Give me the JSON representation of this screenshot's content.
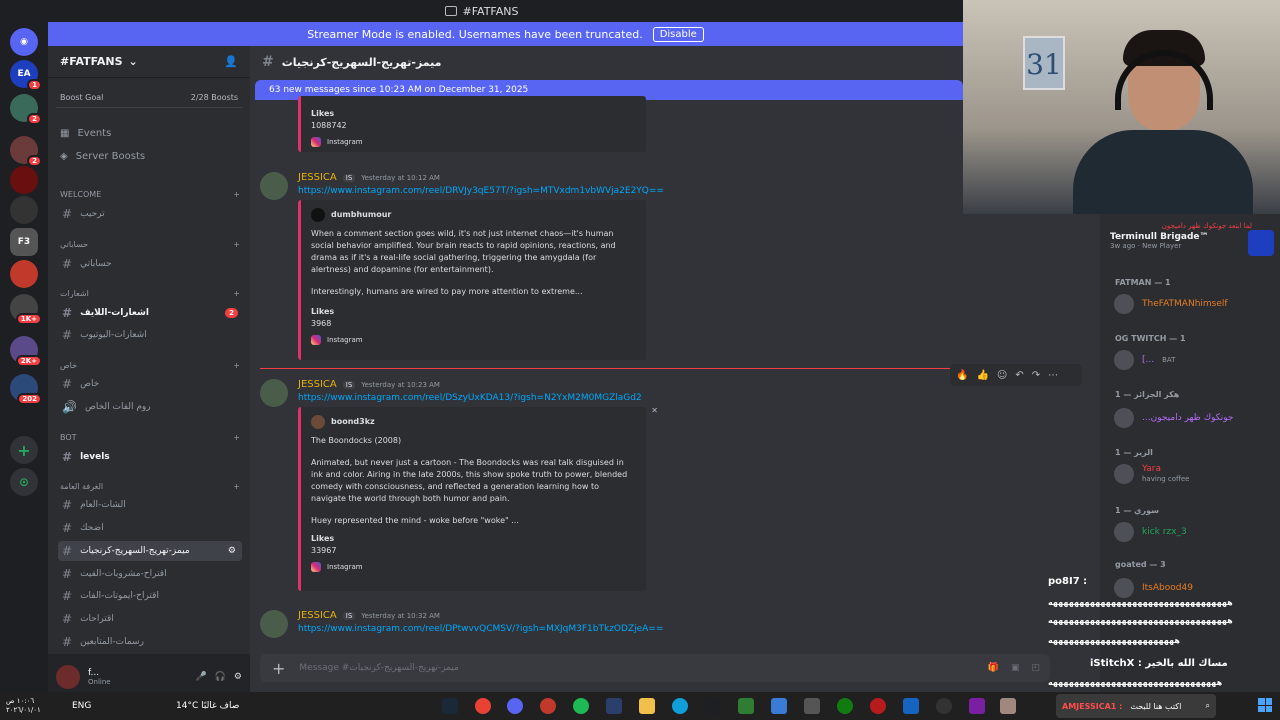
{
  "window": {
    "title": "#FATFANS"
  },
  "banner": {
    "text": "Streamer Mode is enabled. Usernames have been truncated.",
    "button": "Disable"
  },
  "servers": [
    {
      "label": "EA",
      "badge": "1",
      "color": "#1d3fbf"
    },
    {
      "label": "",
      "badge": "2",
      "color": "#3a6b5a"
    },
    {
      "label": "",
      "badge": "2",
      "color": "#6b3a3a"
    },
    {
      "label": "",
      "badge": "",
      "color": "#6a0f0f"
    },
    {
      "label": "",
      "badge": "",
      "color": "#333"
    },
    {
      "label": "F3",
      "badge": "",
      "color": "#555"
    },
    {
      "label": "",
      "badge": "",
      "color": "#c0392b"
    },
    {
      "label": "",
      "badge": "1K+",
      "color": "#444"
    },
    {
      "label": "",
      "badge": "2K+",
      "color": "#5a4a8a"
    },
    {
      "label": "",
      "badge": "202",
      "color": "#2b4a7a"
    }
  ],
  "channel_sidebar": {
    "server_name": "#FATFANS",
    "boost": {
      "label": "Boost Goal",
      "value": "2/28 Boosts"
    },
    "nav": [
      {
        "label": "Events"
      },
      {
        "label": "Server Boosts"
      }
    ],
    "categories": {
      "welcome": "WELCOME",
      "accounts": "حساباتي",
      "notify": "اشعارات",
      "private": "خاص",
      "bot": "BOT",
      "general": "الغرفة العامة"
    },
    "channels": {
      "welcome": "ترحيب",
      "accounts": "حساباتي",
      "notify_live": "اشعارات-اللايف",
      "notify_live_count": "2",
      "notify_yt": "اشعارات-اليوتيوب",
      "private": "خاص",
      "private_room": "روم الفات الخاص",
      "levels": "levels",
      "chat": "الشات-العام",
      "introductions": "اضحك",
      "active": "ميمز-تهريج-السهريج-كرنجيات",
      "suggestions_drinks": "اقتراح-مشروبات-الفيت",
      "suggestions_emotes": "اقتراح-ايموتات-الفات",
      "suggestions": "اقتراحات",
      "fan_art": "رسمات-المتابعين"
    },
    "user": {
      "name": "f...",
      "status": "Online"
    }
  },
  "chat": {
    "channel_title": "ميمز-تهريج-السهريج-كرنجيات",
    "new_messages": "63 new messages since 10:23 AM on December 31, 2025",
    "input_placeholder": "Message #ميمز-تهريج-السهريج-كرنجيات",
    "top_embed": {
      "likes_label": "Likes",
      "likes": "1088742",
      "source": "Instagram"
    },
    "messages": [
      {
        "author": "JESSICA",
        "tag": "IS",
        "time": "Yesterday at 10:12 AM",
        "link": "https://www.instagram.com/reel/DRVJy3qE57T/?igsh=MTVxdm1vbWVja2E2YQ==",
        "embed": {
          "author": "dumbhumour",
          "desc1": "When a comment section goes wild, it's not just internet chaos—it's human social behavior amplified. Your brain reacts to rapid opinions, reactions, and drama as if it's a real-life social gathering, triggering the amygdala (for alertness) and dopamine (for entertainment).",
          "desc2": "Interestingly, humans are wired to pay more attention to extreme...",
          "likes_label": "Likes",
          "likes": "3968",
          "source": "Instagram"
        }
      },
      {
        "author": "JESSICA",
        "tag": "IS",
        "time": "Yesterday at 10:23 AM",
        "link": "https://www.instagram.com/reel/DSzyUxKDA13/?igsh=N2YxM2M0MGZlaGd2",
        "embed": {
          "author": "boond3kz",
          "title": "The Boondocks (2008)",
          "desc1": "Animated, but never just a cartoon - The Boondocks was real talk disguised in ink and color. Airing in the late 2000s, this show spoke truth to power, blended comedy with consciousness, and reflected a generation learning how to navigate the world through both humor and pain.",
          "desc2": "Huey represented the mind - woke before \"woke\" ...",
          "likes_label": "Likes",
          "likes": "33967",
          "source": "Instagram"
        }
      },
      {
        "author": "JESSICA",
        "tag": "IS",
        "time": "Yesterday at 10:32 AM",
        "link": "https://www.instagram.com/reel/DPtwvvQCMSV/?igsh=MXJqM3F1bTkzODZjeA=="
      }
    ]
  },
  "members": {
    "top_card": {
      "subtitle": "لما ابتعد جونكوك ظهر داميجون",
      "name": "Terminull Brigade™",
      "meta": "3w ago · New Player"
    },
    "groups": [
      {
        "title": "FATMAN — 1",
        "members": [
          {
            "name": "TheFATMANhimself",
            "sub": ""
          }
        ]
      },
      {
        "title": "OG TWITCH — 1",
        "members": [
          {
            "name": "[...",
            "sub": "BAT"
          }
        ]
      },
      {
        "title": "هكر الجزائر — 1",
        "members": [
          {
            "name": "...جونكوك ظهر داميجون",
            "sub": ""
          }
        ]
      },
      {
        "title": "الزير — 1",
        "members": [
          {
            "name": "Yara",
            "sub": "having coffee"
          }
        ]
      },
      {
        "title": "سوري — 1",
        "members": [
          {
            "name": "kick rzx_3",
            "sub": ""
          }
        ]
      },
      {
        "title": "goated — 3",
        "members": [
          {
            "name": "ItsAbood49",
            "sub": ""
          }
        ]
      }
    ]
  },
  "stream_overlay": {
    "lines": [
      {
        "user": "po8I7 :",
        "text": ""
      },
      {
        "user": "",
        "text": "ههههههههههههههههههههههههههههههههههه"
      },
      {
        "user": "",
        "text": "ههههههههههههههههههههههههههههههههههه"
      },
      {
        "user": "",
        "text": "ههههههههههههههههههههههههه"
      },
      {
        "user": "iStitchX :",
        "text": "مساك الله بالخير"
      },
      {
        "user": "",
        "text": "ههههههههههههههههههههههههههههههههه"
      },
      {
        "user": "AMJESSICA1 :",
        "text": "اكتب هنا للبحث"
      }
    ]
  },
  "taskbar": {
    "weather": "14°C  صاف غالبًا",
    "lang": "ENG",
    "clock_time": "١٠:٠٦ ص",
    "clock_date": "٢٠٢٦/٠١/٠١"
  },
  "colors": {
    "accent": "#5865f2",
    "author": "#e9b200",
    "link": "#00a8fc",
    "badge": "#f23f43"
  }
}
